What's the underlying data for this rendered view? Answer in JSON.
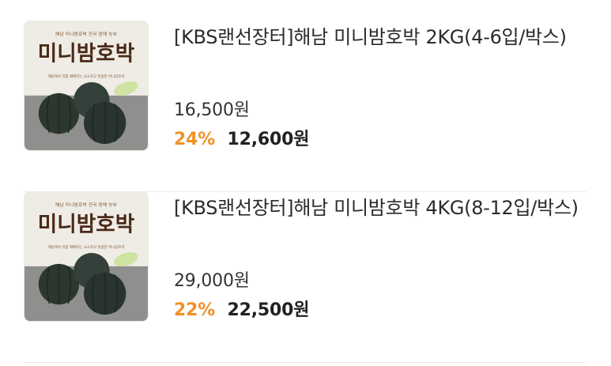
{
  "products": [
    {
      "title": "[KBS랜선장터]해남 미니밤호박 2KG(4-6입/박스)",
      "original_price": "16,500원",
      "discount_rate": "24%",
      "sale_price": "12,600원",
      "image": {
        "label_top": "해남 미니밤호박 전국 판매 농부",
        "label_main": "미니밤호박",
        "label_sub": "해남에서 직접 재배하는 고소하고 달콤한 미니밤호박"
      }
    },
    {
      "title": "[KBS랜선장터]해남 미니밤호박 4KG(8-12입/박스)",
      "original_price": "29,000원",
      "discount_rate": "22%",
      "sale_price": "22,500원",
      "image": {
        "label_top": "해남 미니밤호박 전국 판매 농부",
        "label_main": "미니밤호박",
        "label_sub": "해남에서 직접 재배하는 고소하고 달콤한 미니밤호박"
      }
    }
  ],
  "colors": {
    "discount": "#f0912a",
    "pumpkin": "#2f3a30",
    "logo_text": "#4a2a16"
  }
}
